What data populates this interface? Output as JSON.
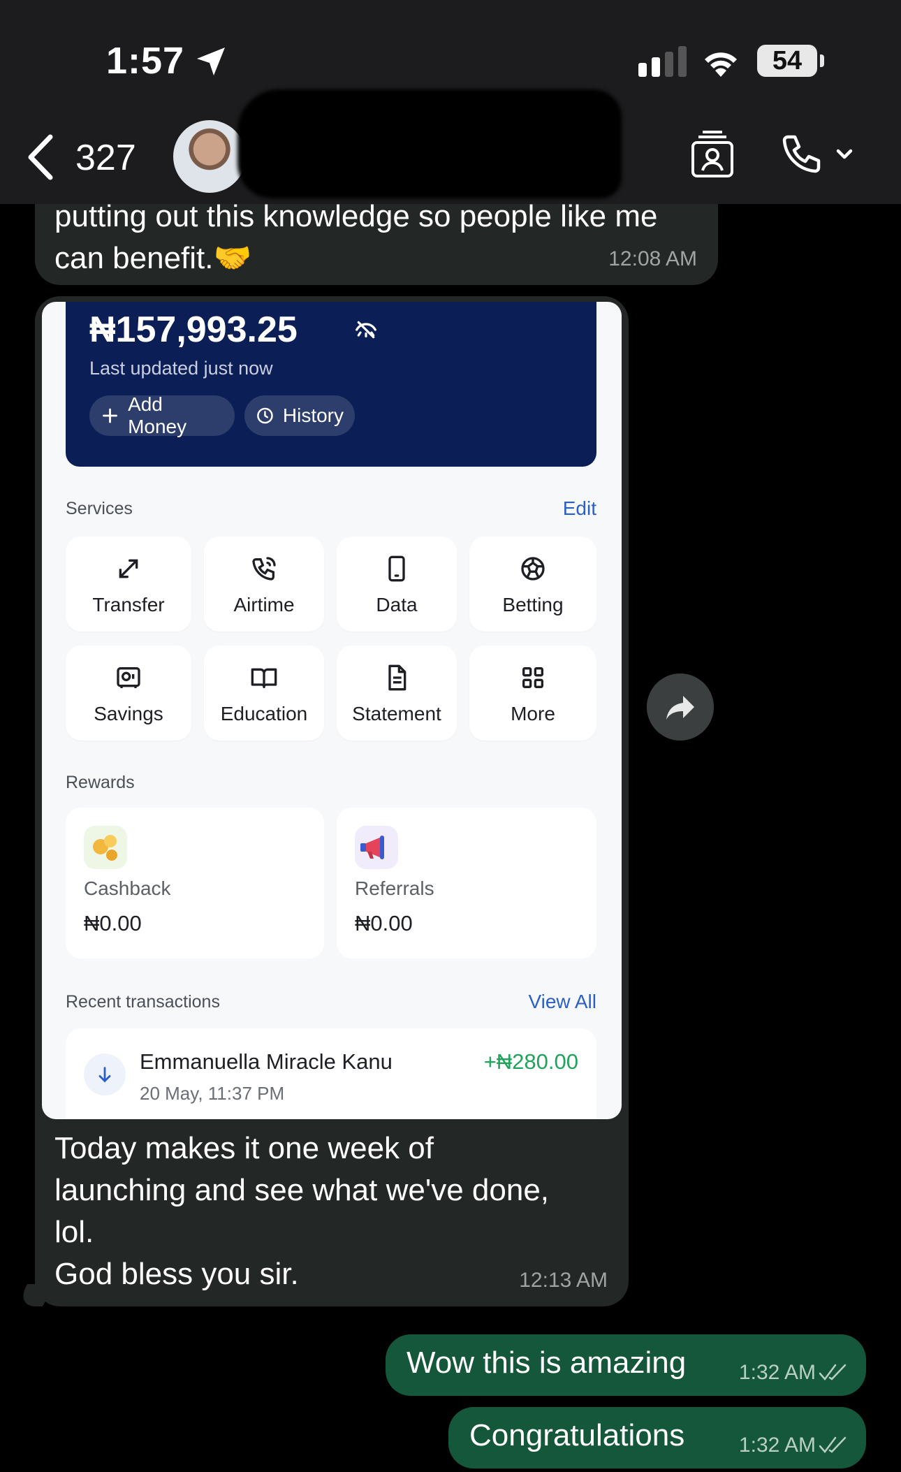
{
  "status_bar": {
    "time": "1:57",
    "battery": "54"
  },
  "header": {
    "back_count": "327"
  },
  "messages": {
    "incoming_1": {
      "text": "putting out this knowledge so people like me can benefit.🤝",
      "time": "12:08 AM"
    },
    "incoming_2": {
      "text_lines": [
        "Today makes it one week of",
        "launching and see what we've done,",
        "lol.",
        "God bless you sir."
      ],
      "time": "12:13 AM"
    },
    "outgoing": [
      {
        "text": "Wow this is amazing",
        "time": "1:32 AM"
      },
      {
        "text": "Congratulations",
        "time": "1:32 AM"
      }
    ]
  },
  "screenshot": {
    "balance": "₦157,993.25",
    "updated": "Last updated just now",
    "add_money": "Add Money",
    "history": "History",
    "services_label": "Services",
    "services_edit": "Edit",
    "services": [
      "Transfer",
      "Airtime",
      "Data",
      "Betting",
      "Savings",
      "Education",
      "Statement",
      "More"
    ],
    "rewards_label": "Rewards",
    "rewards": [
      {
        "label": "Cashback",
        "value": "₦0.00"
      },
      {
        "label": "Referrals",
        "value": "₦0.00"
      }
    ],
    "recent_label": "Recent transactions",
    "view_all": "View All",
    "transaction": {
      "name": "Emmanuella Miracle Kanu",
      "date": "20 May, 11:37 PM",
      "amount": "+₦280.00"
    }
  },
  "colors": {
    "card_navy": "#0b1f56",
    "incoming_bubble": "#232726",
    "outgoing_bubble": "#15573a",
    "positive": "#1fa45a",
    "link_blue": "#2a5fc8"
  }
}
